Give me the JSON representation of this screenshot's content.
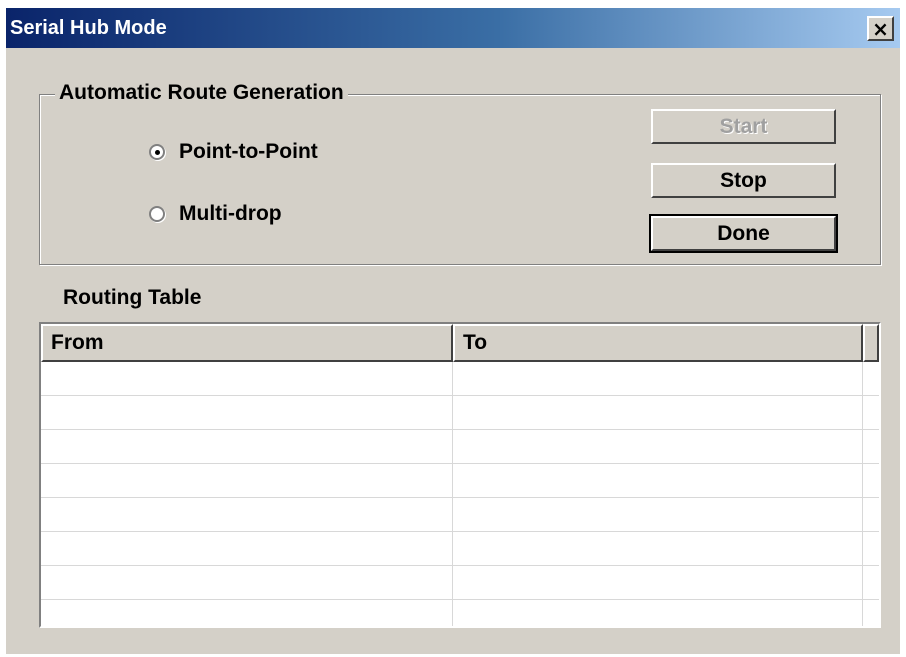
{
  "window": {
    "title": "Serial Hub Mode",
    "close_label": "×"
  },
  "route_generation": {
    "legend": "Automatic Route Generation",
    "options": [
      {
        "label": "Point-to-Point",
        "selected": true
      },
      {
        "label": "Multi-drop",
        "selected": false
      }
    ]
  },
  "buttons": {
    "start": "Start",
    "stop": "Stop",
    "done": "Done"
  },
  "routing_table": {
    "label": "Routing Table",
    "columns": [
      "From",
      "To"
    ],
    "rows": [
      [
        "",
        ""
      ],
      [
        "",
        ""
      ],
      [
        "",
        ""
      ],
      [
        "",
        ""
      ],
      [
        "",
        ""
      ],
      [
        "",
        ""
      ],
      [
        "",
        ""
      ],
      [
        "",
        ""
      ]
    ]
  }
}
